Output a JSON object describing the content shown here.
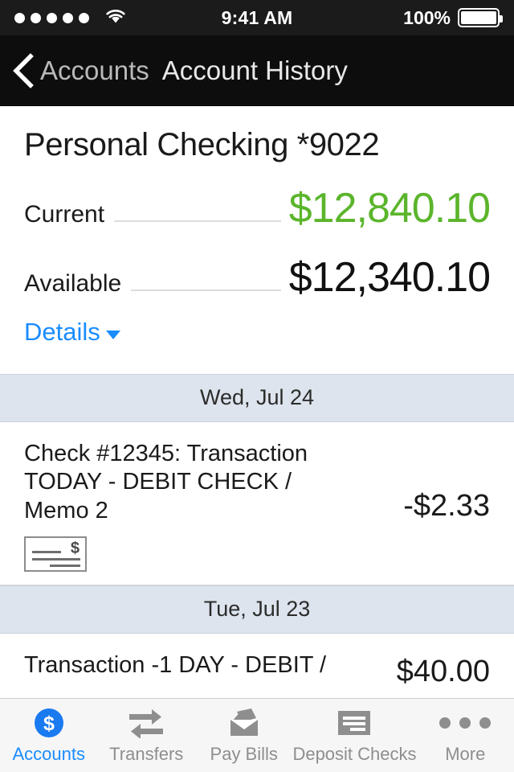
{
  "status_bar": {
    "signal_dots": 5,
    "wifi_icon": "wifi-icon",
    "time": "9:41 AM",
    "battery_percent": "100%",
    "battery_icon": "battery-full-icon"
  },
  "nav_bar": {
    "back_icon": "back-chevron-icon",
    "back_label": "Accounts",
    "title": "Account History"
  },
  "account": {
    "title": "Personal Checking *9022",
    "current_label": "Current",
    "current_amount": "$12,840.10",
    "current_color": "#5bb52b",
    "available_label": "Available",
    "available_amount": "$12,340.10",
    "details_label": "Details",
    "details_caret_icon": "chevron-down-icon",
    "details_color": "#1a8cff"
  },
  "sections": [
    {
      "date": "Wed, Jul 24",
      "transactions": [
        {
          "description": "Check #12345: Transaction TODAY - DEBIT CHECK / Memo 2",
          "amount": "-$2.33",
          "check_image_icon": "check-image-icon",
          "check_dollar_glyph": "$"
        }
      ]
    },
    {
      "date": "Tue, Jul 23",
      "transactions": [
        {
          "description": "Transaction -1 DAY - DEBIT /",
          "amount": "$40.00"
        }
      ]
    }
  ],
  "tab_bar": {
    "tabs": [
      {
        "label": "Accounts",
        "icon": "dollar-circle-icon",
        "active": true
      },
      {
        "label": "Transfers",
        "icon": "transfer-arrows-icon",
        "active": false
      },
      {
        "label": "Pay Bills",
        "icon": "envelope-icon",
        "active": false
      },
      {
        "label": "Deposit Checks",
        "icon": "check-deposit-icon",
        "active": false
      },
      {
        "label": "More",
        "icon": "ellipsis-icon",
        "active": false
      }
    ]
  }
}
